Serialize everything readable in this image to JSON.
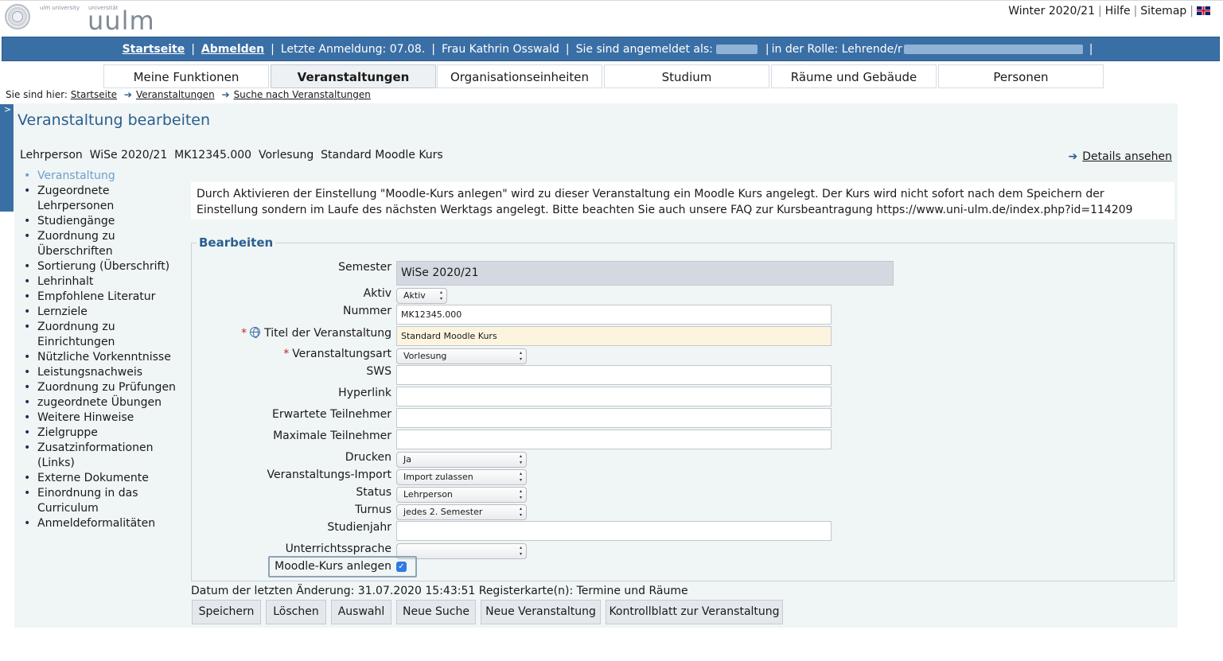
{
  "header": {
    "logo_small_left": "ulm university",
    "logo_small_right": "universität",
    "logo_text": "uulm",
    "semester_link": "Winter 2020/21",
    "help_link": "Hilfe",
    "sitemap_link": "Sitemap",
    "language_icon": "uk-flag-icon"
  },
  "status_bar": {
    "home": "Startseite",
    "logout": "Abmelden",
    "last_login": "Letzte Anmeldung:  07.08.",
    "user": "Frau Kathrin Osswald",
    "logged_in_as": "Sie sind angemeldet als:",
    "role": "in der Rolle: Lehrende/r",
    "separator": "|"
  },
  "nav_tabs": [
    {
      "label": "Meine Funktionen",
      "active": false
    },
    {
      "label": "Veranstaltungen",
      "active": true
    },
    {
      "label": "Organisationseinheiten",
      "active": false
    },
    {
      "label": "Studium",
      "active": false
    },
    {
      "label": "Räume und Gebäude",
      "active": false
    },
    {
      "label": "Personen",
      "active": false
    }
  ],
  "breadcrumb": {
    "prefix": "Sie sind hier:",
    "items": [
      "Startseite",
      "Veranstaltungen",
      "Suche nach Veranstaltungen"
    ]
  },
  "page": {
    "title": "Veranstaltung bearbeiten",
    "subinfo": "Lehrperson  WiSe 2020/21  MK12345.000  Vorlesung  Standard Moodle Kurs",
    "details_link": "Details ansehen",
    "info_text": "Durch Aktivieren der Einstellung \"Moodle-Kurs anlegen\" wird zu dieser Veranstaltung ein Moodle Kurs angelegt. Der Kurs wird nicht sofort nach dem Speichern der Einstellung sondern im Laufe des nächsten Werktags angelegt. Bitte beachten Sie auch unsere FAQ zur Kursbeantragung https://www.uni-ulm.de/index.php?id=114209"
  },
  "left_menu": {
    "items": [
      {
        "label": "Veranstaltung",
        "active": true
      },
      {
        "label": "Zugeordnete Lehrpersonen"
      },
      {
        "label": "Studiengänge"
      },
      {
        "label": "Zuordnung zu Überschriften"
      },
      {
        "label": "Sortierung (Überschrift)"
      },
      {
        "label": "Lehrinhalt"
      },
      {
        "label": "Empfohlene Literatur"
      },
      {
        "label": "Lernziele"
      },
      {
        "label": "Zuordnung zu Einrichtungen"
      },
      {
        "label": "Nützliche Vorkenntnisse"
      },
      {
        "label": "Leistungsnachweis"
      },
      {
        "label": "Zuordnung zu Prüfungen"
      },
      {
        "label": "zugeordnete Übungen"
      },
      {
        "label": "Weitere Hinweise"
      },
      {
        "label": "Zielgruppe"
      },
      {
        "label": "Zusatzinformationen (Links)"
      },
      {
        "label": "Externe Dokumente"
      },
      {
        "label": "Einordnung in das Curriculum"
      },
      {
        "label": "Anmeldeformalitäten"
      }
    ]
  },
  "form": {
    "legend": "Bearbeiten",
    "semester": {
      "label": "Semester",
      "value": "WiSe 2020/21"
    },
    "aktiv": {
      "label": "Aktiv",
      "value": "Aktiv"
    },
    "nummer": {
      "label": "Nummer",
      "value": "MK12345.000"
    },
    "titel": {
      "label": "Titel der Veranstaltung",
      "value": "Standard Moodle Kurs",
      "required_mark": "*"
    },
    "art": {
      "label": "Veranstaltungsart",
      "value": "Vorlesung",
      "required_mark": "*"
    },
    "sws": {
      "label": "SWS",
      "value": ""
    },
    "hyperlink": {
      "label": "Hyperlink",
      "value": ""
    },
    "erwartete": {
      "label": "Erwartete Teilnehmer",
      "value": ""
    },
    "maximale": {
      "label": "Maximale Teilnehmer",
      "value": ""
    },
    "drucken": {
      "label": "Drucken",
      "value": "Ja"
    },
    "import": {
      "label": "Veranstaltungs-Import",
      "value": "Import zulassen"
    },
    "status": {
      "label": "Status",
      "value": "Lehrperson"
    },
    "turnus": {
      "label": "Turnus",
      "value": "jedes 2. Semester"
    },
    "studienjahr": {
      "label": "Studienjahr",
      "value": ""
    },
    "sprache": {
      "label": "Unterrichtssprache",
      "value": ""
    },
    "moodle": {
      "label": "Moodle-Kurs anlegen",
      "checked": true
    }
  },
  "last_modified": "Datum der letzten Änderung: 31.07.2020 15:43:51 Registerkarte(n): Termine und Räume",
  "buttons": {
    "save": "Speichern",
    "delete": "Löschen",
    "select": "Auswahl",
    "new_search": "Neue Suche",
    "new_event": "Neue Veranstaltung",
    "control_sheet": "Kontrollblatt zur Veranstaltung"
  },
  "colors": {
    "accent_blue": "#3a6fa6",
    "title_blue": "#2a5f8f",
    "panel_bg": "#f0f5f5",
    "required_red": "#c0262d"
  }
}
